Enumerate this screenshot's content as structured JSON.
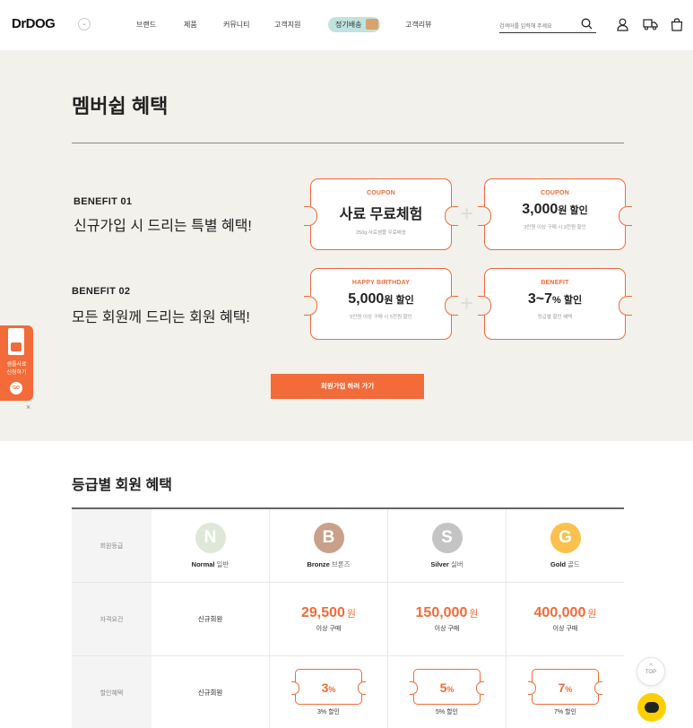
{
  "header": {
    "logo": "DrDOG",
    "nav": [
      "브랜드",
      "제품",
      "커뮤니티",
      "고객지원",
      "정기배송",
      "고객리뷰"
    ],
    "search_placeholder": "검색어를 입력해 주세요",
    "icons": [
      "search-icon",
      "user-icon",
      "delivery-truck-icon",
      "shopping-bag-icon"
    ]
  },
  "membership": {
    "title": "멤버쉽 혜택",
    "benefit1": {
      "label": "BENEFIT 01",
      "text": "신규가입 시 드리는 특별 혜택!",
      "coupons": [
        {
          "tag": "COUPON",
          "main": "사료 무료체험",
          "unit": "",
          "desc": "250g 사료샘플 무료배송"
        },
        {
          "tag": "COUPON",
          "main": "3,000",
          "unit": "원 할인",
          "desc": "3만원 이상 구매 시 3천원 할인"
        }
      ]
    },
    "benefit2": {
      "label": "BENEFIT 02",
      "text": "모든 회원께 드리는 회원 혜택!",
      "coupons": [
        {
          "tag": "HAPPY BIRTHDAY",
          "main": "5,000",
          "unit": "원 할인",
          "desc": "5만원 이상 구매 시 5천원 할인"
        },
        {
          "tag": "BENEFIT",
          "main": "3~7",
          "unit": "% 할인",
          "desc": "등급별 할인 혜택"
        }
      ]
    },
    "cta": "회원가입 하러 가기",
    "side_banner": {
      "line1": "샘플사료",
      "line2": "신청하기",
      "go": "GO",
      "close": "×"
    }
  },
  "grades": {
    "title": "등급별 회원 혜택",
    "row_headers": [
      "회원등급",
      "자격요건",
      "할인혜택"
    ],
    "columns": [
      {
        "letter": "N",
        "name": "Normal",
        "name_ko": "일반",
        "color": "#dfe8d8",
        "requirement": "신규회원",
        "price": "",
        "price_unit": "",
        "price_sub": "",
        "discount": "신규회원",
        "coupon": "",
        "coupon_unit": "",
        "coupon_sub": ""
      },
      {
        "letter": "B",
        "name": "Bronze",
        "name_ko": "브론즈",
        "color": "#c9a08a",
        "requirement": "",
        "price": "29,500",
        "price_unit": "원",
        "price_sub": "이상 구매",
        "discount": "",
        "coupon": "3",
        "coupon_unit": "%",
        "coupon_sub": "3% 할인"
      },
      {
        "letter": "S",
        "name": "Silver",
        "name_ko": "실버",
        "color": "#c4c4c4",
        "requirement": "",
        "price": "150,000",
        "price_unit": "원",
        "price_sub": "이상 구매",
        "discount": "",
        "coupon": "5",
        "coupon_unit": "%",
        "coupon_sub": "5% 할인"
      },
      {
        "letter": "G",
        "name": "Gold",
        "name_ko": "골드",
        "color": "#fcc14d",
        "requirement": "",
        "price": "400,000",
        "price_unit": "원",
        "price_sub": "이상 구매",
        "discount": "",
        "coupon": "7",
        "coupon_unit": "%",
        "coupon_sub": "7% 할인"
      }
    ]
  },
  "floating": {
    "top_label": "TOP",
    "top_arrow": "^"
  },
  "colors": {
    "accent": "#f26b38",
    "beige": "#f2f1ec",
    "pill": "#bfe3df",
    "chat": "#fcd000"
  }
}
